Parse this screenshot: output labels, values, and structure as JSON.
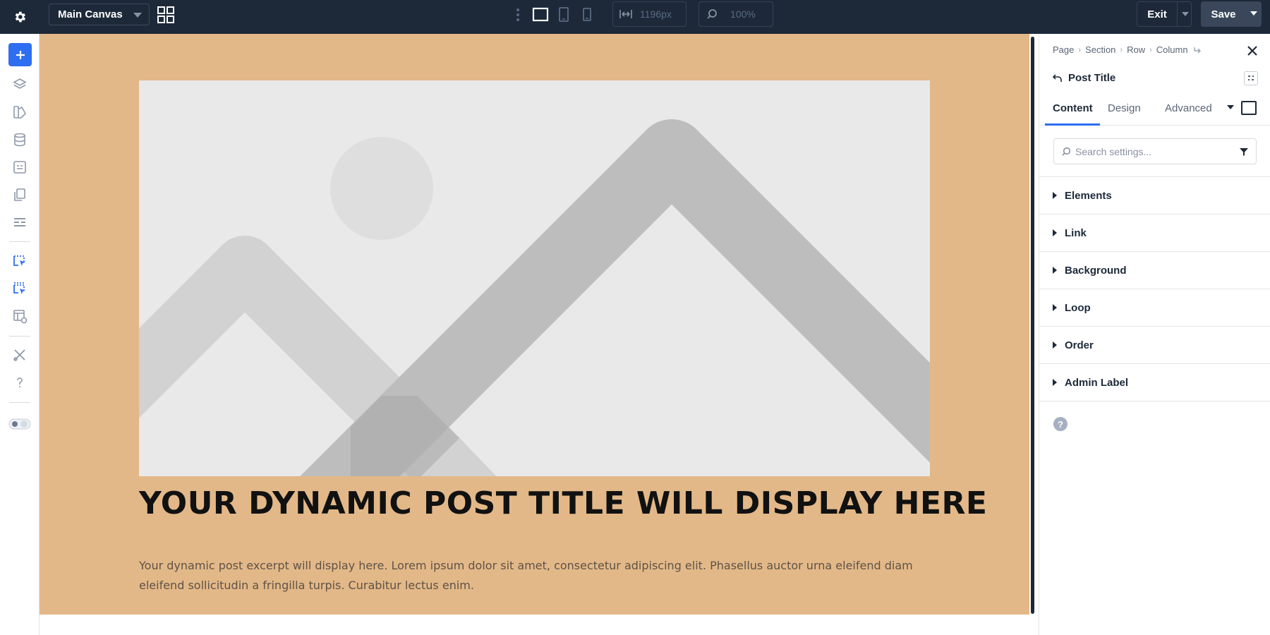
{
  "topbar": {
    "canvas_name": "Main Canvas",
    "width_value": "1196px",
    "zoom_value": "100%",
    "exit_label": "Exit",
    "save_label": "Save"
  },
  "canvas": {
    "background_color": "#e3b888",
    "post_title": "YOUR DYNAMIC POST TITLE WILL DISPLAY HERE",
    "post_excerpt": "Your dynamic post excerpt will display here. Lorem ipsum dolor sit amet, consectetur adipiscing elit. Phasellus auctor urna eleifend diam eleifend sollicitudin a fringilla turpis. Curabitur lectus enim."
  },
  "panel": {
    "breadcrumb": [
      "Page",
      "Section",
      "Row",
      "Column"
    ],
    "module_name": "Post Title",
    "tabs": [
      "Content",
      "Design",
      "Advanced"
    ],
    "active_tab": "Content",
    "search_placeholder": "Search settings...",
    "groups": [
      "Elements",
      "Link",
      "Background",
      "Loop",
      "Order",
      "Admin Label"
    ],
    "help_glyph": "?"
  },
  "colors": {
    "topbar": "#1d2939",
    "accent": "#2e6ef0"
  }
}
